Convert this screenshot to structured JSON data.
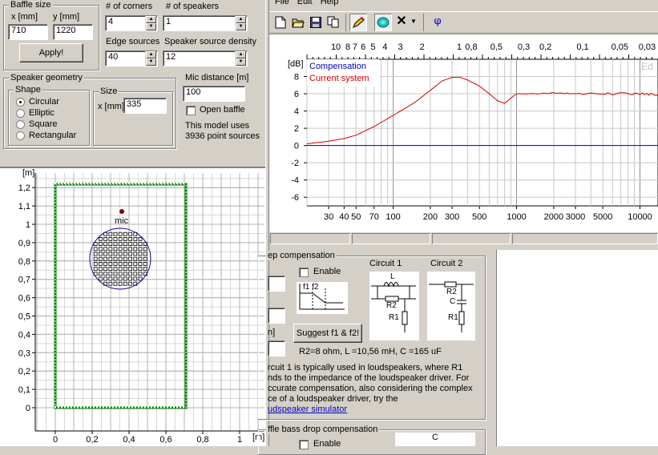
{
  "baffle": {
    "title": "Baffle size",
    "x_label": "x [mm]",
    "y_label": "y [mm]",
    "x_value": "710",
    "y_value": "1220",
    "apply_label": "Apply!"
  },
  "corners": {
    "label": "# of corners",
    "value": "4"
  },
  "speakers": {
    "label": "# of speakers",
    "value": "1"
  },
  "edge_sources": {
    "label": "Edge sources",
    "value": "40"
  },
  "speaker_density": {
    "label": "Speaker source density",
    "value": "12"
  },
  "geometry": {
    "title": "Speaker geometry",
    "shape_title": "Shape",
    "shapes": [
      "Circular",
      "Elliptic",
      "Square",
      "Rectangular"
    ],
    "selected": "Circular",
    "size_title": "Size",
    "size_label": "x [mm]",
    "size_value": "335"
  },
  "mic": {
    "label": "Mic distance [m]",
    "value": "100",
    "open_baffle_label": "Open baffle",
    "model_info_1": "This model uses",
    "model_info_2": "3936 point sources"
  },
  "menu": [
    "File",
    "Edit",
    "Help"
  ],
  "toolbar_icons": [
    "new-icon",
    "open-icon",
    "save-icon",
    "copy-icon",
    "pencil-icon",
    "speaker-icon",
    "delete-icon",
    "dropdown-icon",
    "phi-icon"
  ],
  "phi_glyph": "φ",
  "baffle_plot": {
    "y_unit": "[m]",
    "x_unit": "[m]",
    "y_ticks": [
      "1,2",
      "1,1",
      "1",
      "0,9",
      "0,8",
      "0,7",
      "0,6",
      "0,5",
      "0,4",
      "0,3",
      "0,2",
      "0,1",
      "0"
    ],
    "x_ticks": [
      "0",
      "0,2",
      "0,4",
      "0,6",
      "0,8",
      "1"
    ],
    "mic_label": "mic"
  },
  "freq_chart": {
    "y_unit": "[dB]",
    "legend": [
      "Compensation",
      "Current system"
    ],
    "legend_colors": [
      "#0000c0",
      "#d00000"
    ],
    "y_ticks": [
      "8",
      "6",
      "4",
      "2",
      "0",
      "-2",
      "-4",
      "-6"
    ],
    "x_ticks": [
      "30",
      "40",
      "50",
      "70",
      "100",
      "200",
      "300",
      "500",
      "1000",
      "2000",
      "3000",
      "5000",
      "10000"
    ],
    "top_ticks": [
      "10",
      "8",
      "7",
      "6",
      "5",
      "4",
      "3",
      "2",
      "1",
      "0,8",
      "0,5",
      "0,3",
      "0,2",
      "0,1",
      "0,05",
      "0,03"
    ],
    "corner_text": "Ed"
  },
  "chart_data": {
    "type": "line",
    "xlabel": "",
    "ylabel": "[dB]",
    "x_scale": "log",
    "xlim": [
      20,
      14000
    ],
    "ylim": [
      -7,
      10
    ],
    "series": [
      {
        "name": "Compensation",
        "x": [
          20,
          14000
        ],
        "y": [
          0,
          0
        ]
      },
      {
        "name": "Current system",
        "x": [
          20,
          30,
          40,
          50,
          70,
          100,
          150,
          200,
          250,
          300,
          350,
          400,
          500,
          600,
          700,
          800,
          900,
          1000,
          1500,
          2000,
          3000,
          5000,
          7000,
          10000,
          14000
        ],
        "y": [
          0.2,
          0.5,
          0.8,
          1.2,
          2.2,
          3.5,
          5.0,
          6.4,
          7.5,
          7.9,
          7.9,
          7.6,
          6.9,
          6.0,
          5.2,
          4.9,
          5.5,
          6.0,
          6.0,
          6.1,
          6.0,
          6.0,
          6.0,
          6.0,
          5.9
        ]
      }
    ]
  },
  "compensation": {
    "title": "ep compensation",
    "enable_label": "Enable",
    "filter_labels": "f1 f2",
    "circuit1_title": "Circuit 1",
    "circuit2_title": "Circuit 2",
    "c1_labels": [
      "L",
      "R2",
      "R1"
    ],
    "c2_labels": [
      "R2",
      "C",
      "R1"
    ],
    "unit_stub": "n]",
    "suggest_label": "Suggest f1 & f2!",
    "result_text": "R2=8 ohm, L =10,56 mH, C =165 uF",
    "desc_1": "rcuit 1 is typically used in loudspeakers, where R1",
    "desc_2": "nds to the impedance of the loudspeaker driver. For",
    "desc_3": "ccurate compensation, also considering the complex",
    "desc_4": "ce of a loudspeaker driver, try the",
    "link_text": "udspeaker simulator"
  },
  "bass_drop": {
    "title": "ffle bass drop compensation",
    "enable_stub": "Enable",
    "c_label": "C"
  }
}
